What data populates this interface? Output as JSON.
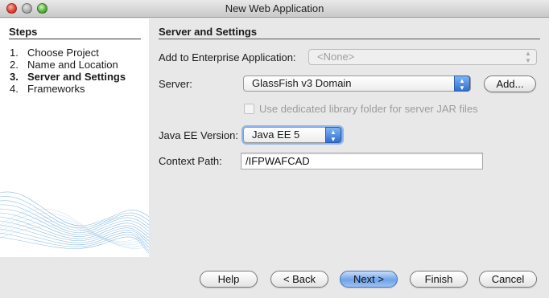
{
  "window": {
    "title": "New Web Application"
  },
  "steps": {
    "heading": "Steps",
    "items": [
      {
        "num": "1.",
        "label": "Choose Project"
      },
      {
        "num": "2.",
        "label": "Name and Location"
      },
      {
        "num": "3.",
        "label": "Server and Settings"
      },
      {
        "num": "4.",
        "label": "Frameworks"
      }
    ],
    "current_index": 2
  },
  "main": {
    "heading": "Server and Settings",
    "enterprise_app": {
      "label": "Add to Enterprise Application:",
      "value": "<None>",
      "enabled": false
    },
    "server": {
      "label": "Server:",
      "value": "GlassFish v3 Domain",
      "add_button": "Add..."
    },
    "dedicated_library": {
      "label": "Use dedicated library folder for server JAR files",
      "checked": false,
      "enabled": false
    },
    "java_ee_version": {
      "label": "Java EE Version:",
      "value": "Java EE 5"
    },
    "context_path": {
      "label": "Context Path:",
      "value": "/IFPWAFCAD"
    }
  },
  "buttons": {
    "help": "Help",
    "back": "< Back",
    "next": "Next >",
    "finish": "Finish",
    "cancel": "Cancel",
    "default": "next"
  },
  "colors": {
    "accent": "#5b93e6",
    "wave": "#6aa8d8"
  }
}
